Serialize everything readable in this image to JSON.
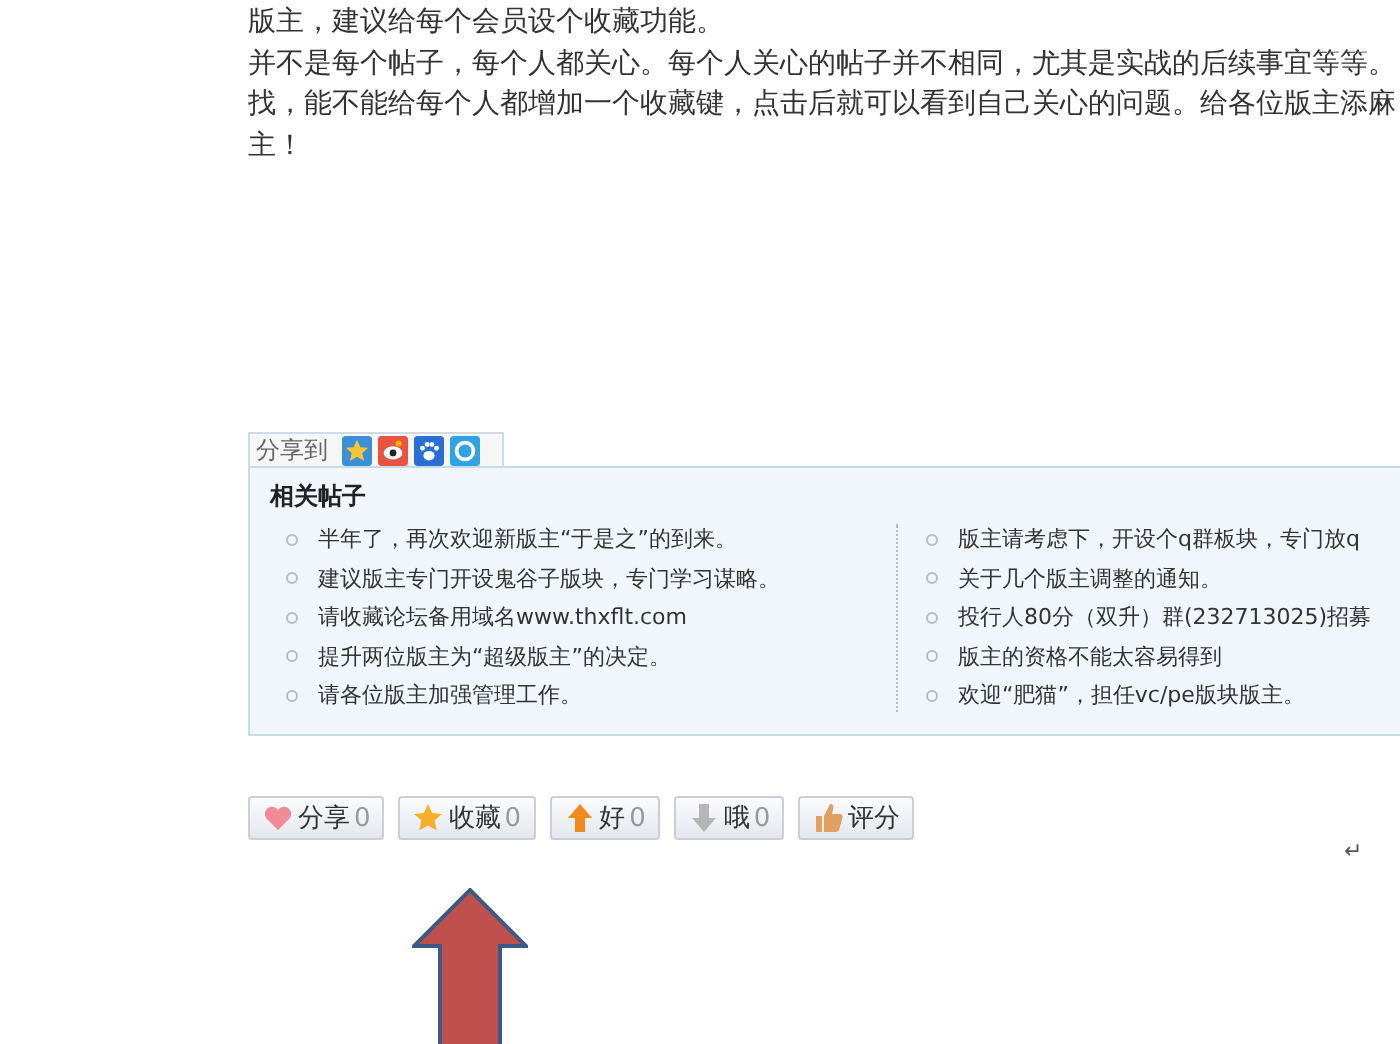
{
  "post_lines": [
    "版主，建议给每个会员设个收藏功能。",
    "并不是每个帖子，每个人都关心。每个人关心的帖子并不相同，尤其是实战的后续事宜等等。",
    "找，能不能给每个人都增加一个收藏键，点击后就可以看到自己关心的问题。给各位版主添麻",
    "主！"
  ],
  "share": {
    "label": "分享到",
    "services": [
      {
        "kind": "star"
      },
      {
        "kind": "eye"
      },
      {
        "kind": "paw"
      },
      {
        "kind": "ring"
      }
    ]
  },
  "related": {
    "title": "相关帖子",
    "left": [
      "半年了，再次欢迎新版主“于是之”的到来。",
      "建议版主专门开设鬼谷子版块，专门学习谋略。",
      "请收藏论坛备用域名www.thxflt.com",
      "提升两位版主为“超级版主”的决定。",
      "请各位版主加强管理工作。"
    ],
    "right": [
      "版主请考虑下，开设个q群板块，专门放q",
      "关于几个版主调整的通知。",
      "投行人80分（双升）群(232713025)招募",
      "版主的资格不能太容易得到",
      "欢迎“肥猫”，担任vc/pe版块版主。"
    ]
  },
  "actions": [
    {
      "kind": "heart",
      "label": "分享",
      "count": "0"
    },
    {
      "kind": "star",
      "label": "收藏",
      "count": "0"
    },
    {
      "kind": "up",
      "label": "好",
      "count": "0"
    },
    {
      "kind": "down",
      "label": "哦",
      "count": "0"
    },
    {
      "kind": "thumb",
      "label": "评分"
    }
  ],
  "return_mark": "↵"
}
